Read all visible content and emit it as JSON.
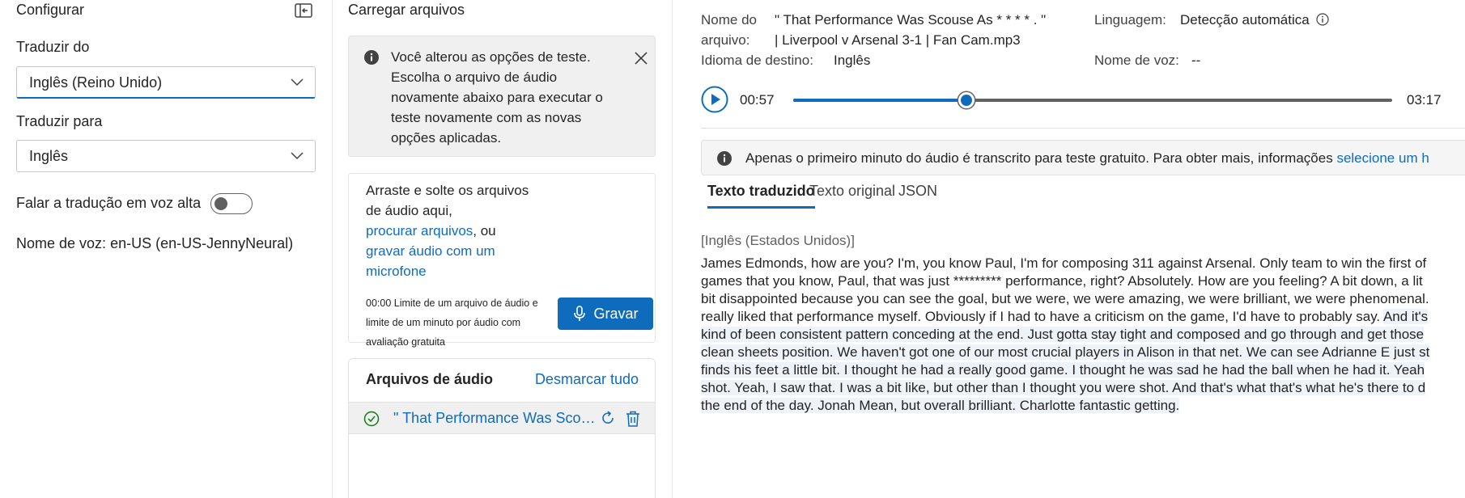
{
  "left": {
    "title": "Configurar",
    "translate_from_label": "Traduzir do",
    "translate_from_value": "Inglês (Reino Unido)",
    "translate_to_label": "Traduzir para",
    "translate_to_value": "Inglês",
    "speak_label": "Falar a tradução em voz alta",
    "speak_on": false,
    "voice_key": "Nome de voz:",
    "voice_value": "en-US (en-US-JennyNeural)"
  },
  "middle": {
    "title": "Carregar arquivos",
    "message": "Você alterou as opções de teste. Escolha o arquivo de áudio novamente abaixo para executar o teste novamente com as novas opções aplicadas.",
    "drop_text_1": "Arraste e solte os arquivos de áudio aqui,",
    "browse_link": "procurar arquivos",
    "drop_text_2": ", ou",
    "record_link": "gravar áudio com um microfone",
    "limit_text": "00:00 Limite de um arquivo de áudio e limite de um minuto por áudio com avaliação gratuita",
    "record_button": "Gravar",
    "files_title": "Arquivos de áudio",
    "clear_all": "Desmarcar tudo",
    "file_name": "\" That Performance Was Scouse As  * * * * . \" | Liverpool v Arsenal 3-1 | Fan Cam.mp3"
  },
  "right": {
    "file_name_label_1": "Nome do",
    "file_name_label_2": "arquivo:",
    "file_name_value_1": "\" That Performance Was Scouse As  * * * * . \"",
    "file_name_value_2": "|  Liverpool v Arsenal 3-1  |  Fan Cam.mp3",
    "target_lang_label": "Idioma de destino:",
    "target_lang_value": "Inglês",
    "language_label": "Linguagem:",
    "language_value": "Detecção automática",
    "voice_name_label": "Nome de voz:",
    "voice_name_value": "--",
    "time_current": "00:57",
    "time_total": "03:17",
    "progress": 0.289,
    "notice_text": "Apenas o primeiro minuto do áudio é transcrito para teste gratuito. Para obter mais, informações ",
    "notice_link": "selecione um h",
    "tabs": [
      "Texto traduzido",
      "Texto original",
      "JSON"
    ],
    "lang_tag": "[Inglês (Estados Unidos)]",
    "transcript_lines": [
      {
        "a": "James Edmonds, how are you? I'm, you know Paul, I'm for composing 311 against Arsenal. Only team to win the first of",
        "b": ""
      },
      {
        "a": "games that you know, Paul, that was just ********* performance, right? Absolutely. How are you feeling? A bit down, a lit",
        "b": ""
      },
      {
        "a": "bit disappointed because you can see the goal, but we were, we were amazing, we were brilliant, we were phenomenal. ",
        "b": ""
      },
      {
        "a": "really liked that performance myself. Obviously if I had to have a criticism on the game, I'd have to probably say. ",
        "b": "And it's"
      },
      {
        "a": "",
        "b": "kind of been consistent pattern conceding at the end. Just gotta stay tight and composed and go through and get those"
      },
      {
        "a": "",
        "b": "clean sheets position. We haven't got one of our most crucial players in Alison in that net. We can see Adrianne E just st"
      },
      {
        "a": "",
        "b": "finds his feet a little bit. I thought he had a really good game. I thought he was sad he had the ball when he had it. Yeah"
      },
      {
        "a": "",
        "b": "shot. Yeah, I saw that. I was a bit like, but other than I thought you were shot. And that's what that's what he's there to d"
      },
      {
        "a": "",
        "b": "the end of the day. Jonah Mean, but overall brilliant. Charlotte fantastic getting."
      }
    ]
  }
}
